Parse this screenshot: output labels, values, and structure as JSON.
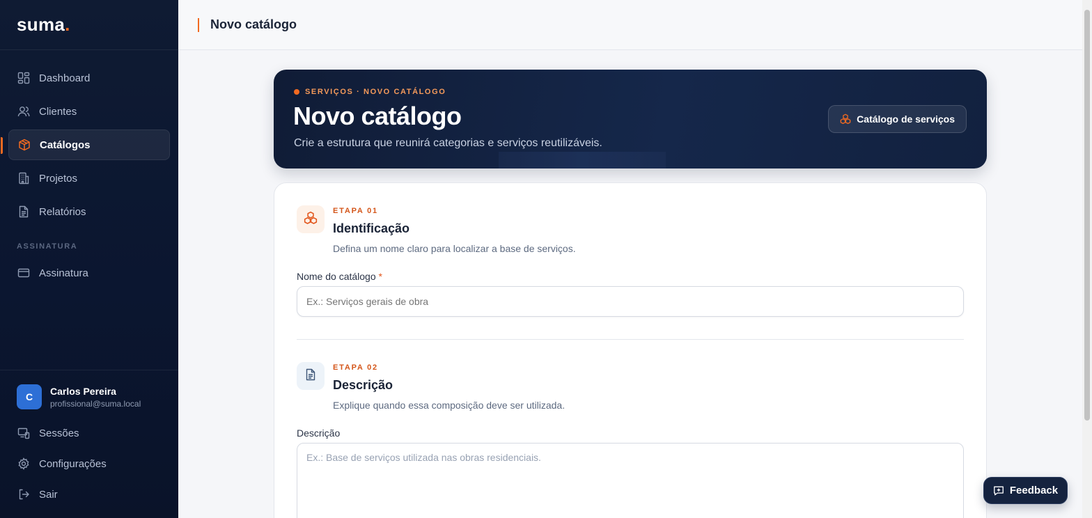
{
  "brand": {
    "name": "suma",
    "dot": "."
  },
  "sidebar": {
    "items": [
      {
        "label": "Dashboard",
        "icon": "dashboard-icon"
      },
      {
        "label": "Clientes",
        "icon": "users-icon"
      },
      {
        "label": "Catálogos",
        "icon": "package-icon",
        "active": true
      },
      {
        "label": "Projetos",
        "icon": "building-icon"
      },
      {
        "label": "Relatórios",
        "icon": "report-icon"
      }
    ],
    "section_label": "ASSINATURA",
    "section_items": [
      {
        "label": "Assinatura",
        "icon": "credit-card-icon"
      }
    ],
    "user": {
      "initial": "C",
      "name": "Carlos Pereira",
      "email": "profissional@suma.local"
    },
    "bottom_links": [
      {
        "label": "Sessões",
        "icon": "devices-icon"
      },
      {
        "label": "Configurações",
        "icon": "gear-icon"
      },
      {
        "label": "Sair",
        "icon": "logout-icon"
      }
    ]
  },
  "topbar": {
    "title": "Novo catálogo"
  },
  "hero": {
    "kicker": "SERVIÇOS · NOVO CATÁLOGO",
    "title": "Novo catálogo",
    "subtitle": "Crie a estrutura que reunirá categorias e serviços reutilizáveis.",
    "button_label": "Catálogo de serviços"
  },
  "form": {
    "step1": {
      "kicker": "ETAPA 01",
      "title": "Identificação",
      "description": "Defina um nome claro para localizar a base de serviços.",
      "field_label": "Nome do catálogo",
      "required_mark": "*",
      "placeholder": "Ex.: Serviços gerais de obra"
    },
    "step2": {
      "kicker": "ETAPA 02",
      "title": "Descrição",
      "description": "Explique quando essa composição deve ser utilizada.",
      "field_label": "Descrição",
      "placeholder": "Ex.: Base de serviços utilizada nas obras residenciais."
    }
  },
  "feedback": {
    "label": "Feedback"
  },
  "colors": {
    "accent": "#f26a21",
    "sidebar_bg": "#0f1b33",
    "avatar": "#2d6fd6"
  }
}
